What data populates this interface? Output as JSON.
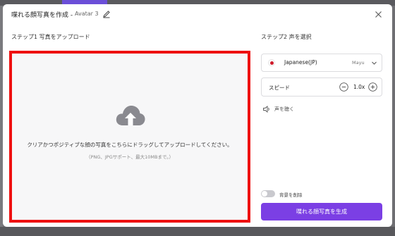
{
  "header": {
    "title": "喋れる顔写真を作成 -",
    "avatar_name": "Avatar 3",
    "edit_icon": "pencil-icon",
    "close_icon": "close-icon"
  },
  "step1": {
    "label": "ステップ1 写真をアップロード",
    "upload_icon": "cloud-upload-icon",
    "upload_text": "クリアかつポジティブな顔の写真をこちらにドラッグしてアップロードしてください。",
    "upload_hint": "（PNG、JPGサポート、最大10MBまで。）",
    "highlight_color": "#ee1010"
  },
  "step2": {
    "label": "ステップ2 声を選択",
    "voice": {
      "flag_icon": "japan-flag-icon",
      "language": "Japanese(JP)",
      "name": "Mayu"
    },
    "speed": {
      "label": "スピード",
      "value": "1.0x"
    },
    "listen_label": "声を聴く"
  },
  "footer": {
    "remove_bg_label": "背景を削除",
    "remove_bg_on": false,
    "generate_label": "喋れる顔写真を生成",
    "accent_color": "#7b3fe4"
  }
}
